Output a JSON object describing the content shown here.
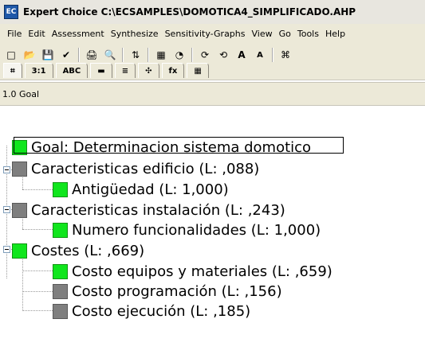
{
  "titlebar": {
    "title": "Expert Choice    C:\\ECSAMPLES\\DOMOTICA4_SIMPLIFICADO.AHP"
  },
  "menu": {
    "items": [
      {
        "label": "File"
      },
      {
        "label": "Edit"
      },
      {
        "label": "Assessment"
      },
      {
        "label": "Synthesize"
      },
      {
        "label": "Sensitivity-Graphs"
      },
      {
        "label": "View"
      },
      {
        "label": "Go"
      },
      {
        "label": "Tools"
      },
      {
        "label": "Help"
      }
    ]
  },
  "toolbar": {
    "icons": [
      "new-file-icon",
      "open-folder-icon",
      "save-icon",
      "wand-icon",
      "print-icon",
      "preview-icon",
      "tree-node-icon",
      "grid-icon",
      "chart-icon",
      "rotate-cw-icon",
      "rotate-ccw-icon",
      "font-increase-icon",
      "font-decrease-icon",
      "network-icon"
    ],
    "tabs": [
      "",
      "3:1",
      "ABC",
      "",
      "",
      "",
      "fx",
      ""
    ]
  },
  "path": {
    "text": "1.0 Goal"
  },
  "tree": {
    "goal": "Goal: Determinacion sistema domotico",
    "nodes": [
      {
        "label": "Caracteristicas edificio (L: ,088)",
        "color": "gray"
      },
      {
        "label": "Antigüedad (L: 1,000)",
        "color": "green"
      },
      {
        "label": "Caracteristicas instalación (L: ,243)",
        "color": "gray"
      },
      {
        "label": "Numero funcionalidades (L: 1,000)",
        "color": "green"
      },
      {
        "label": "Costes (L: ,669)",
        "color": "green"
      },
      {
        "label": "Costo equipos y materiales (L: ,659)",
        "color": "green"
      },
      {
        "label": "Costo programación (L: ,156)",
        "color": "gray"
      },
      {
        "label": "Costo ejecución (L: ,185)",
        "color": "gray"
      }
    ]
  }
}
